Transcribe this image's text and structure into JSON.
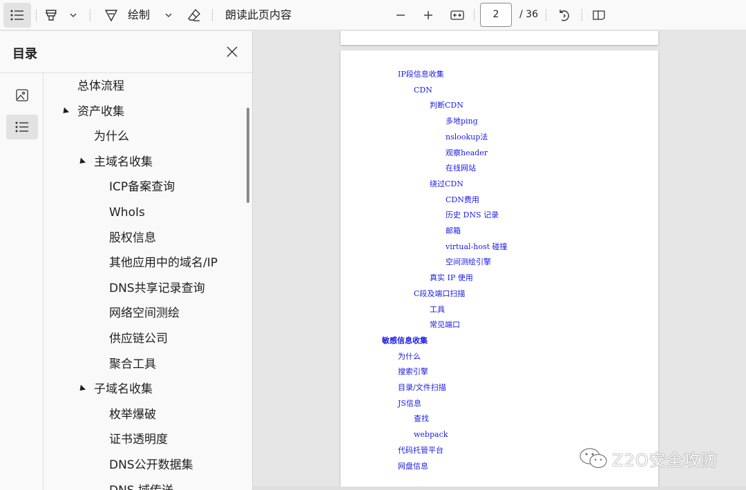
{
  "toolbar": {
    "draw_label": "绘制",
    "read_aloud_label": "朗读此页内容",
    "page_current": "2",
    "page_total": "/ 36"
  },
  "sidebar": {
    "title": "目录",
    "outline": [
      {
        "label": "总体流程",
        "level": 0,
        "expandable": false
      },
      {
        "label": "资产收集",
        "level": 0,
        "expandable": true
      },
      {
        "label": "为什么",
        "level": 1,
        "expandable": false
      },
      {
        "label": "主域名收集",
        "level": 1,
        "expandable": true
      },
      {
        "label": "ICP备案查询",
        "level": 2,
        "expandable": false
      },
      {
        "label": "WhoIs",
        "level": 2,
        "expandable": false
      },
      {
        "label": "股权信息",
        "level": 2,
        "expandable": false
      },
      {
        "label": "其他应用中的域名/IP",
        "level": 2,
        "expandable": false
      },
      {
        "label": "DNS共享记录查询",
        "level": 2,
        "expandable": false
      },
      {
        "label": "网络空间测绘",
        "level": 2,
        "expandable": false
      },
      {
        "label": "供应链公司",
        "level": 2,
        "expandable": false
      },
      {
        "label": "聚合工具",
        "level": 2,
        "expandable": false
      },
      {
        "label": "子域名收集",
        "level": 1,
        "expandable": true
      },
      {
        "label": "枚举爆破",
        "level": 2,
        "expandable": false
      },
      {
        "label": "证书透明度",
        "level": 2,
        "expandable": false
      },
      {
        "label": "DNS公开数据集",
        "level": 2,
        "expandable": false
      },
      {
        "label": "DNS 域传送",
        "level": 2,
        "expandable": false
      }
    ]
  },
  "document": {
    "toc": [
      {
        "text": "IP段信息收集",
        "level": 1,
        "bold": false
      },
      {
        "text": "CDN",
        "level": 2,
        "bold": false
      },
      {
        "text": "判断CDN",
        "level": 3,
        "bold": false
      },
      {
        "text": "多地ping",
        "level": 4,
        "bold": false
      },
      {
        "text": "nslookup法",
        "level": 4,
        "bold": false
      },
      {
        "text": "观察header",
        "level": 4,
        "bold": false
      },
      {
        "text": "在线网站",
        "level": 4,
        "bold": false
      },
      {
        "text": "绕过CDN",
        "level": 3,
        "bold": false
      },
      {
        "text": "CDN费用",
        "level": 4,
        "bold": false
      },
      {
        "text": "历史 DNS 记录",
        "level": 4,
        "bold": false
      },
      {
        "text": "邮箱",
        "level": 4,
        "bold": false
      },
      {
        "text": "virtual-host 碰撞",
        "level": 4,
        "bold": false
      },
      {
        "text": "空间测绘引擎",
        "level": 4,
        "bold": false
      },
      {
        "text": "真实 IP 使用",
        "level": 3,
        "bold": false
      },
      {
        "text": "C段及端口扫描",
        "level": 2,
        "bold": false
      },
      {
        "text": "工具",
        "level": 3,
        "bold": false
      },
      {
        "text": "常见端口",
        "level": 3,
        "bold": false
      },
      {
        "text": "敏感信息收集",
        "level": 0,
        "bold": true
      },
      {
        "text": "为什么",
        "level": 1,
        "bold": false
      },
      {
        "text": "搜索引擎",
        "level": 1,
        "bold": false
      },
      {
        "text": "目录/文件扫描",
        "level": 1,
        "bold": false
      },
      {
        "text": "JS信息",
        "level": 1,
        "bold": false
      },
      {
        "text": "查找",
        "level": 2,
        "bold": false
      },
      {
        "text": "webpack",
        "level": 2,
        "bold": false
      },
      {
        "text": "代码托管平台",
        "level": 1,
        "bold": false
      },
      {
        "text": "网盘信息",
        "level": 1,
        "bold": false
      }
    ]
  },
  "watermark": {
    "text": "Z2O安全攻防"
  },
  "colors": {
    "link_blue": "#1a1ae6",
    "toolbar_bg": "#f9f9f9",
    "doc_bg": "#e6e6e6"
  }
}
